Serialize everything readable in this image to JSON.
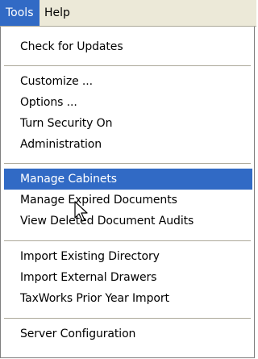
{
  "menubar": {
    "items": [
      {
        "label": "Tools"
      },
      {
        "label": "Help"
      }
    ]
  },
  "menu": {
    "items": [
      {
        "label": "Check for Updates"
      },
      {
        "label": "Customize ..."
      },
      {
        "label": "Options ..."
      },
      {
        "label": "Turn Security On"
      },
      {
        "label": "Administration"
      },
      {
        "label": "Manage Cabinets",
        "highlighted": true
      },
      {
        "label": "Manage Expired Documents"
      },
      {
        "label": "View Deleted Document Audits"
      },
      {
        "label": "Import Existing Directory"
      },
      {
        "label": "Import External Drawers"
      },
      {
        "label": "TaxWorks Prior Year Import"
      },
      {
        "label": "Server Configuration"
      }
    ]
  },
  "colors": {
    "highlight": "#316ac5",
    "menubar_bg": "#ece9d8",
    "separator": "#aca899"
  },
  "icons": {
    "cursor": "arrow-cursor-icon"
  }
}
